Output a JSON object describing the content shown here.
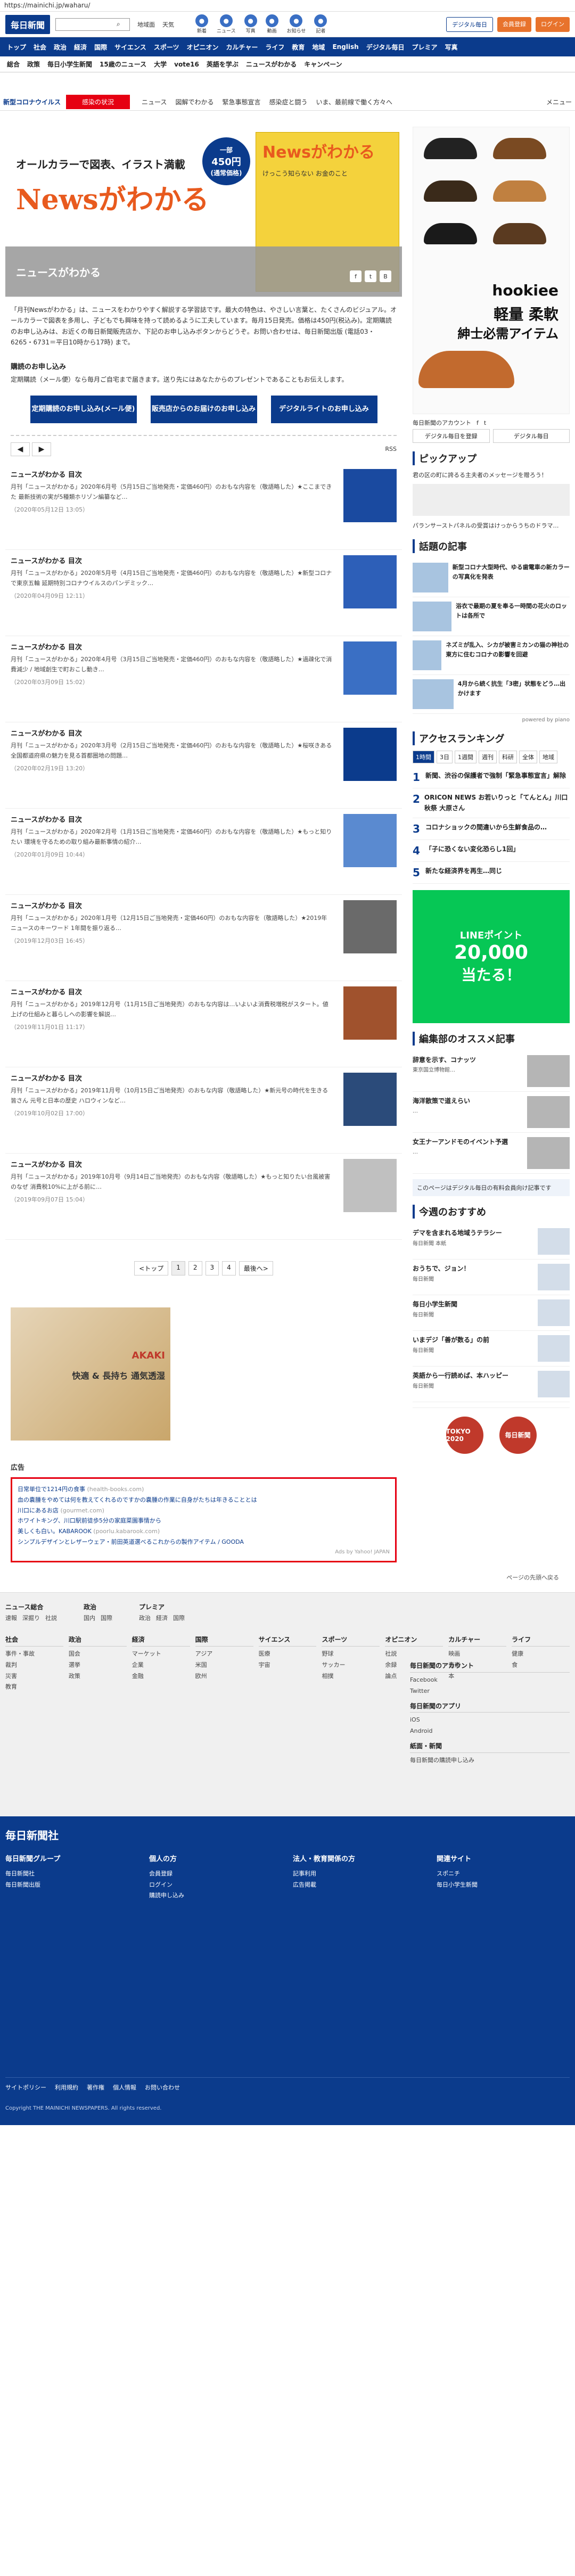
{
  "url": "https://mainichi.jp/waharu/",
  "header": {
    "logo": "毎日新聞",
    "search_btn": "検索",
    "links": [
      "地域面",
      "天気"
    ],
    "icons": [
      {
        "label": "新着",
        "icon": "clock-icon"
      },
      {
        "label": "ニュース",
        "icon": "news-icon"
      },
      {
        "label": "写真",
        "icon": "camera-icon"
      },
      {
        "label": "動画",
        "icon": "video-icon"
      },
      {
        "label": "お知らせ",
        "icon": "bell-icon"
      },
      {
        "label": "記者",
        "icon": "pen-icon"
      }
    ],
    "btn_digital": "デジタル毎日",
    "btn_register": "会員登録",
    "btn_login": "ログイン"
  },
  "nav1": [
    "トップ",
    "社会",
    "政治",
    "経済",
    "国際",
    "サイエンス",
    "スポーツ",
    "オピニオン",
    "カルチャー",
    "ライフ",
    "教育",
    "地域",
    "English",
    "デジタル毎日",
    "プレミア",
    "写真"
  ],
  "nav2": [
    "総合",
    "政策",
    "毎日小学生新聞",
    "15歳のニュース",
    "大学",
    "vote16",
    "英語を学ぶ",
    "ニュースがわかる",
    "キャンペーン"
  ],
  "nav3": {
    "label": "新型コロナウイルス",
    "active": "感染の状況",
    "tabs": [
      "ニュース",
      "図解でわかる",
      "緊急事態宣言",
      "感染症と闘う",
      "いま、最前線で働く方々へ"
    ],
    "menu": "メニュー"
  },
  "hero": {
    "title": "オールカラーで図表、イラスト満載",
    "brand": "Newsがわかる",
    "price_top": "一部",
    "price": "450円",
    "price_sub": "(通常価格)",
    "cover_brand": "Newsがわかる",
    "cover_text": "けっこう知らない お金のこと",
    "band": "ニュースがわかる",
    "social": [
      "f",
      "t",
      "B"
    ]
  },
  "intro": "「月刊Newsがわかる」は、ニュースをわかりやすく解説する学習誌です。最大の特色は、やさしい言葉と、たくさんのビジュアル。オールカラーで図表を多用し、子どもでも興味を持って読めるように工夫しています。毎月15日発売。価格は450円(税込み)。定期購読のお申し込みは、お近くの毎日新聞販売店か、下記のお申し込みボタンからどうぞ。お問い合わせは、毎日新聞出版 (電話03・6265・6731＝平日10時から17時) まで。",
  "sub_heading": "購読のお申し込み",
  "sub_text": "定期購読（メール便）なら毎月ご自宅まで届きます。送り先にはあなたからのプレゼントであることもお伝えします。",
  "buttons": [
    "定期購読のお申し込み(メール便)",
    "販売店からのお届けのお申し込み",
    "デジタルライトのお申し込み"
  ],
  "toolbar": {
    "tools": [
      "◀",
      "▶"
    ],
    "rss": "RSS"
  },
  "articles": [
    {
      "title": "ニュースがわかる 目次",
      "text": "月刊「ニュースがわかる」2020年6月号（5月15日ご当地発売・定価460円）のおもな内容を（敬語略した）★ここまできた 最新技術の実が5種類ホリゾン編纂など…",
      "date": "（2020年05月12日 13:05）"
    },
    {
      "title": "ニュースがわかる 目次",
      "text": "月刊「ニュースがわかる」2020年5月号（4月15日ご当地発売・定価460円）のおもな内容を（敬語略した）★新型コロナで東京五輪 延期特別コロナウイルスのパンデミック…",
      "date": "（2020年04月09日 12:11）"
    },
    {
      "title": "ニュースがわかる 目次",
      "text": "月刊「ニュースがわかる」2020年4月号（3月15日ご当地発売・定価460円）のおもな内容を（敬語略した）★過疎化で消費減少 / 地域創生で町おこし動き…",
      "date": "（2020年03月09日 15:02）"
    },
    {
      "title": "ニュースがわかる 目次",
      "text": "月刊「ニュースがわかる」2020年3月号（2月15日ご当地発売・定価460円）のおもな内容を（敬語略した）★桜咲きある 全国都道府県の魅力を見る首都圏地の問題…",
      "date": "（2020年02月19日 13:20）"
    },
    {
      "title": "ニュースがわかる 目次",
      "text": "月刊「ニュースがわかる」2020年2月号（1月15日ご当地発売・定価460円）のおもな内容を（敬語略した）★もっと知りたい 環境を守るための取り組み最新事情の紹介…",
      "date": "（2020年01月09日 10:44）"
    },
    {
      "title": "ニュースがわかる 目次",
      "text": "月刊「ニュースがわかる」2020年1月号（12月15日ご当地発売・定価460円）のおもな内容を（敬語略した）★2019年 ニュースのキーワード 1年間を振り返る…",
      "date": "（2019年12月03日 16:45）"
    },
    {
      "title": "ニュースがわかる 目次",
      "text": "月刊「ニュースがわかる」2019年12月号（11月15日ご当地発売）のおもな内容は…いよいよ消費税増税がスタート。値上げの仕組みと暮らしへの影響を解説…",
      "date": "（2019年11月01日 11:17）"
    },
    {
      "title": "ニュースがわかる 目次",
      "text": "月刊「ニュースがわかる」2019年11月号（10月15日ご当地発売）のおもな内容（敬語略した）★新元号の時代を生きる皆さん 元号と日本の歴史 ハロウィンなど…",
      "date": "（2019年10月02日 17:00）"
    },
    {
      "title": "ニュースがわかる 目次",
      "text": "月刊「ニュースがわかる」2019年10月号（9月14日ご当地発売）のおもな内容（敬語略した）★もっと知りたい台風被害のなぜ 消費税10%に上がる前に…",
      "date": "（2019年09月07日 15:04）"
    }
  ],
  "pager": [
    "<トップ",
    "1",
    "2",
    "3",
    "4",
    "最後へ>"
  ],
  "bigad": {
    "brand": "AKAKI",
    "text": "快適 & 長持ち 通気透湿"
  },
  "ad_heading": "広告",
  "adbox": [
    {
      "text": "日常単位で1214円の食事",
      "url": "health-books.com"
    },
    {
      "text": "血の嚢腫をやめては何を教えてくれるのですかの嚢腫の作業に自身がたちは年きることとは",
      "url": ""
    },
    {
      "text": "川口にあるお店",
      "url": "gourmet.com"
    },
    {
      "text": "ホワイトキング、川口駅前徒歩5分の家庭菜園事情から",
      "url": ""
    },
    {
      "text": "美しくも白い。KABAROOK",
      "url": "poorlu.kabarook.com"
    },
    {
      "text": "シンプルデザインとレザーウェア・前田英道選べるこれからの製作アイテム / GOODA",
      "url": ""
    }
  ],
  "adbox_footer": "Ads by Yahoo! JAPAN",
  "side": {
    "shoes_brand": "hookiee",
    "shoes_t1": "軽量 柔軟",
    "shoes_t2": "紳士必需アイテム",
    "follow": "毎日新聞のアカウント",
    "follow_btns": [
      "デジタル毎日を登録",
      "デジタル毎日"
    ],
    "pickup_h": "ピックアップ",
    "pickup_text": "君の区の町に誇るる主夫者のメッセージを贈ろう！",
    "pickup_text2": "パランサーストパネルの受賞はけっからうちのドラマ…",
    "topic_h": "話題の記事",
    "topics": [
      "新型コロナ大型時代、ゆる歯電車の新カラーの写真化を発表",
      "浴衣で最期の夏を奉る一時間の花火のロットは各所で",
      "ネズミが乱入、シカが被害ミカンの猫の神社の東方に住むコロナの影響を回避",
      "4月から続く抗生「3密」状態をどう…出かけます"
    ],
    "powered": "powered by piano",
    "rank_h": "アクセスランキング",
    "rank_tabs": [
      "1時間",
      "3日",
      "1週間",
      "週刊",
      "科研",
      "全体",
      "地域"
    ],
    "ranks": [
      "新聞、渋谷の保護者で強制「緊急事態宣言」解除",
      "ORICON NEWS お若いりっと「てんとん」川口秋祭 大原さん",
      "コロナショックの間違いから生鮮食品の…",
      "「子に恐くない変化恐らし1回」",
      "新たな経済界を再生…同じ"
    ],
    "line_t": "LINEポイント",
    "line_v": "20,000",
    "line_s": "当たる！",
    "ed_h": "編集部のオススメ記事",
    "eds": [
      {
        "t": "辞意を示す、コナッツ",
        "p": "東京国立博物館…"
      },
      {
        "t": "海洋散策で道えらい",
        "p": "…"
      },
      {
        "t": "女王ナーアンドモのイベント予選",
        "p": "…"
      }
    ],
    "paywall": "このページはデジタル毎日の有料会員向け記事です",
    "osu_h": "今週のおすすめ",
    "osus": [
      {
        "t": "デマを含まれる地域うテラシー",
        "p": "毎日新聞 本紙"
      },
      {
        "t": "おうちで、ジョン！",
        "p": "毎日新聞"
      },
      {
        "t": "毎日小学生新聞",
        "p": "毎日新聞"
      },
      {
        "t": "いまデジ「善が数る」の前",
        "p": "毎日新聞"
      },
      {
        "t": "英語から一行読めば、本ハッピー",
        "p": "毎日新聞"
      }
    ],
    "olym": [
      "TOKYO 2020",
      "毎日新聞"
    ]
  },
  "pgtop": "ページの先頭へ戻る",
  "footer": {
    "s1": [
      {
        "b": "ニュース総合",
        "items": [
          "速報",
          "深掘り",
          "社説"
        ]
      },
      {
        "b": "政治",
        "items": [
          "国内",
          "国際"
        ]
      },
      {
        "b": "プレミア",
        "items": [
          "政治",
          "経済",
          "国際"
        ]
      }
    ],
    "cols": [
      {
        "b": "社会",
        "items": [
          "事件・事故",
          "裁判",
          "災害",
          "教育"
        ]
      },
      {
        "b": "政治",
        "items": [
          "国会",
          "選挙",
          "政策"
        ]
      },
      {
        "b": "経済",
        "items": [
          "マーケット",
          "企業",
          "金融"
        ]
      },
      {
        "b": "国際",
        "items": [
          "アジア",
          "米国",
          "欧州"
        ]
      },
      {
        "b": "サイエンス",
        "items": [
          "医療",
          "宇宙"
        ]
      },
      {
        "b": "スポーツ",
        "items": [
          "野球",
          "サッカー",
          "相撲"
        ]
      },
      {
        "b": "オピニオン",
        "items": [
          "社説",
          "余録",
          "論点"
        ]
      },
      {
        "b": "カルチャー",
        "items": [
          "映画",
          "音楽",
          "本"
        ]
      },
      {
        "b": "ライフ",
        "items": [
          "健康",
          "食"
        ]
      }
    ],
    "right": [
      {
        "b": "毎日新聞のアカウント",
        "items": [
          "Facebook",
          "Twitter"
        ]
      },
      {
        "b": "毎日新聞のアプリ",
        "items": [
          "iOS",
          "Android"
        ]
      },
      {
        "b": "紙面・新聞",
        "items": [
          "毎日新聞の購読申し込み"
        ]
      }
    ],
    "logo": "毎日新聞社",
    "bcols": [
      {
        "b": "毎日新聞グループ",
        "items": [
          "毎日新聞社",
          "毎日新聞出版"
        ]
      },
      {
        "b": "個人の方",
        "items": [
          "会員登録",
          "ログイン",
          "購読申し込み"
        ]
      },
      {
        "b": "法人・教育関係の方",
        "items": [
          "記事利用",
          "広告掲載"
        ]
      },
      {
        "b": "関連サイト",
        "items": [
          "スポニチ",
          "毎日小学生新聞"
        ]
      }
    ],
    "bot": [
      "サイトポリシー",
      "利用規約",
      "著作権",
      "個人情報",
      "お問い合わせ"
    ],
    "cp": "Copyright THE MAINICHI NEWSPAPERS. All rights reserved."
  }
}
